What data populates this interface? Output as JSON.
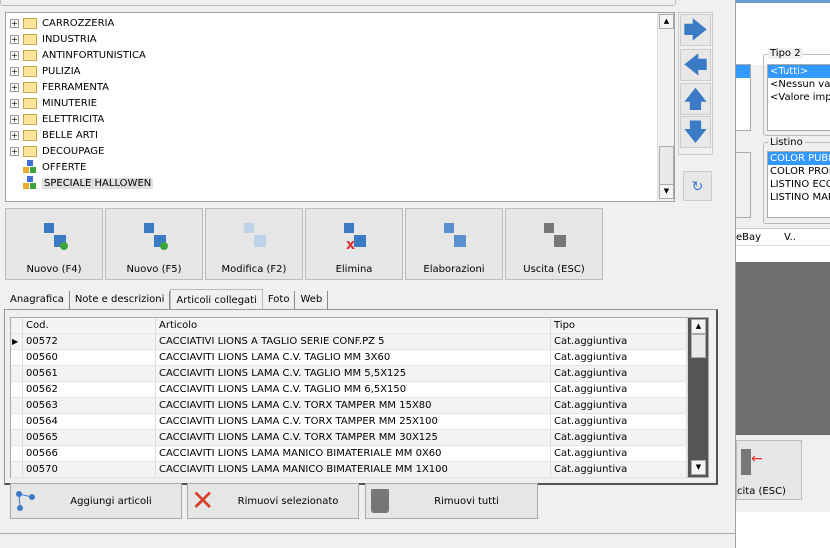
{
  "tree": {
    "items": [
      {
        "label": "CARROZZERIA",
        "type": "folder",
        "expandable": true
      },
      {
        "label": "INDUSTRIA",
        "type": "folder",
        "expandable": true
      },
      {
        "label": "ANTINFORTUNISTICA",
        "type": "folder",
        "expandable": true
      },
      {
        "label": "PULIZIA",
        "type": "folder",
        "expandable": true
      },
      {
        "label": "FERRAMENTA",
        "type": "folder",
        "expandable": true
      },
      {
        "label": "MINUTERIE",
        "type": "folder",
        "expandable": true
      },
      {
        "label": "ELETTRICITA",
        "type": "folder",
        "expandable": true
      },
      {
        "label": "BELLE ARTI",
        "type": "folder",
        "expandable": true
      },
      {
        "label": "DECOUPAGE",
        "type": "folder",
        "expandable": true
      },
      {
        "label": "OFFERTE",
        "type": "group",
        "expandable": false
      },
      {
        "label": "SPECIALE HALLOWEN",
        "type": "group",
        "expandable": false,
        "selected": true
      }
    ]
  },
  "toolbar": [
    {
      "label": "Nuovo (F4)",
      "icon": "new-child-node-icon"
    },
    {
      "label": "Nuovo (F5)",
      "icon": "new-sibling-node-icon"
    },
    {
      "label": "Modifica (F2)",
      "icon": "edit-table-icon"
    },
    {
      "label": "Elimina",
      "icon": "delete-node-icon"
    },
    {
      "label": "Elaborazioni",
      "icon": "processing-gear-icon"
    },
    {
      "label": "Uscita (ESC)",
      "icon": "exit-door-icon"
    }
  ],
  "tabs": [
    {
      "label": "Anagrafica"
    },
    {
      "label": "Note e descrizioni"
    },
    {
      "label": "Articoli collegati",
      "active": true
    },
    {
      "label": "Foto"
    },
    {
      "label": "Web"
    }
  ],
  "grid": {
    "columns": [
      "Cod.",
      "Articolo",
      "Tipo"
    ],
    "rows": [
      [
        "00572",
        "CACCIATIVI LIONS A TAGLIO SERIE CONF.PZ 5",
        "Cat.aggiuntiva"
      ],
      [
        "00560",
        "CACCIAVITI LIONS LAMA C.V. TAGLIO MM 3X60",
        "Cat.aggiuntiva"
      ],
      [
        "00561",
        "CACCIAVITI LIONS LAMA C.V. TAGLIO MM 5,5X125",
        "Cat.aggiuntiva"
      ],
      [
        "00562",
        "CACCIAVITI LIONS LAMA C.V. TAGLIO MM 6,5X150",
        "Cat.aggiuntiva"
      ],
      [
        "00563",
        "CACCIAVITI LIONS LAMA C.V. TORX TAMPER MM 15X80",
        "Cat.aggiuntiva"
      ],
      [
        "00564",
        "CACCIAVITI LIONS LAMA C.V. TORX TAMPER MM 25X100",
        "Cat.aggiuntiva"
      ],
      [
        "00565",
        "CACCIAVITI LIONS LAMA C.V. TORX TAMPER MM 30X125",
        "Cat.aggiuntiva"
      ],
      [
        "00566",
        "CACCIAVITI LIONS LAMA MANICO BIMATERIALE MM 0X60",
        "Cat.aggiuntiva"
      ],
      [
        "00570",
        "CACCIAVITI LIONS LAMA MANICO BIMATERIALE MM 1X100",
        "Cat.aggiuntiva"
      ]
    ]
  },
  "actions": {
    "add": "Aggiungi articoli",
    "remove_selected": "Rimuovi selezionato",
    "remove_all": "Rimuovi tutti"
  },
  "background_window": {
    "tipo2_title": "Tipo 2",
    "tipo2_items": [
      "<Tutti>",
      "<Nessun valo",
      "<Valore impo"
    ],
    "listino_title": "Listino",
    "listino_items": [
      "COLOR PUBB",
      "COLOR PROF",
      "LISTINO ECO",
      "LISTINO MAR"
    ],
    "grid_headers": [
      "eBay",
      "V.."
    ],
    "exit_label": "cita (ESC)"
  },
  "colors": {
    "accent": "#3399ff",
    "arrow": "#3b7ac4"
  }
}
